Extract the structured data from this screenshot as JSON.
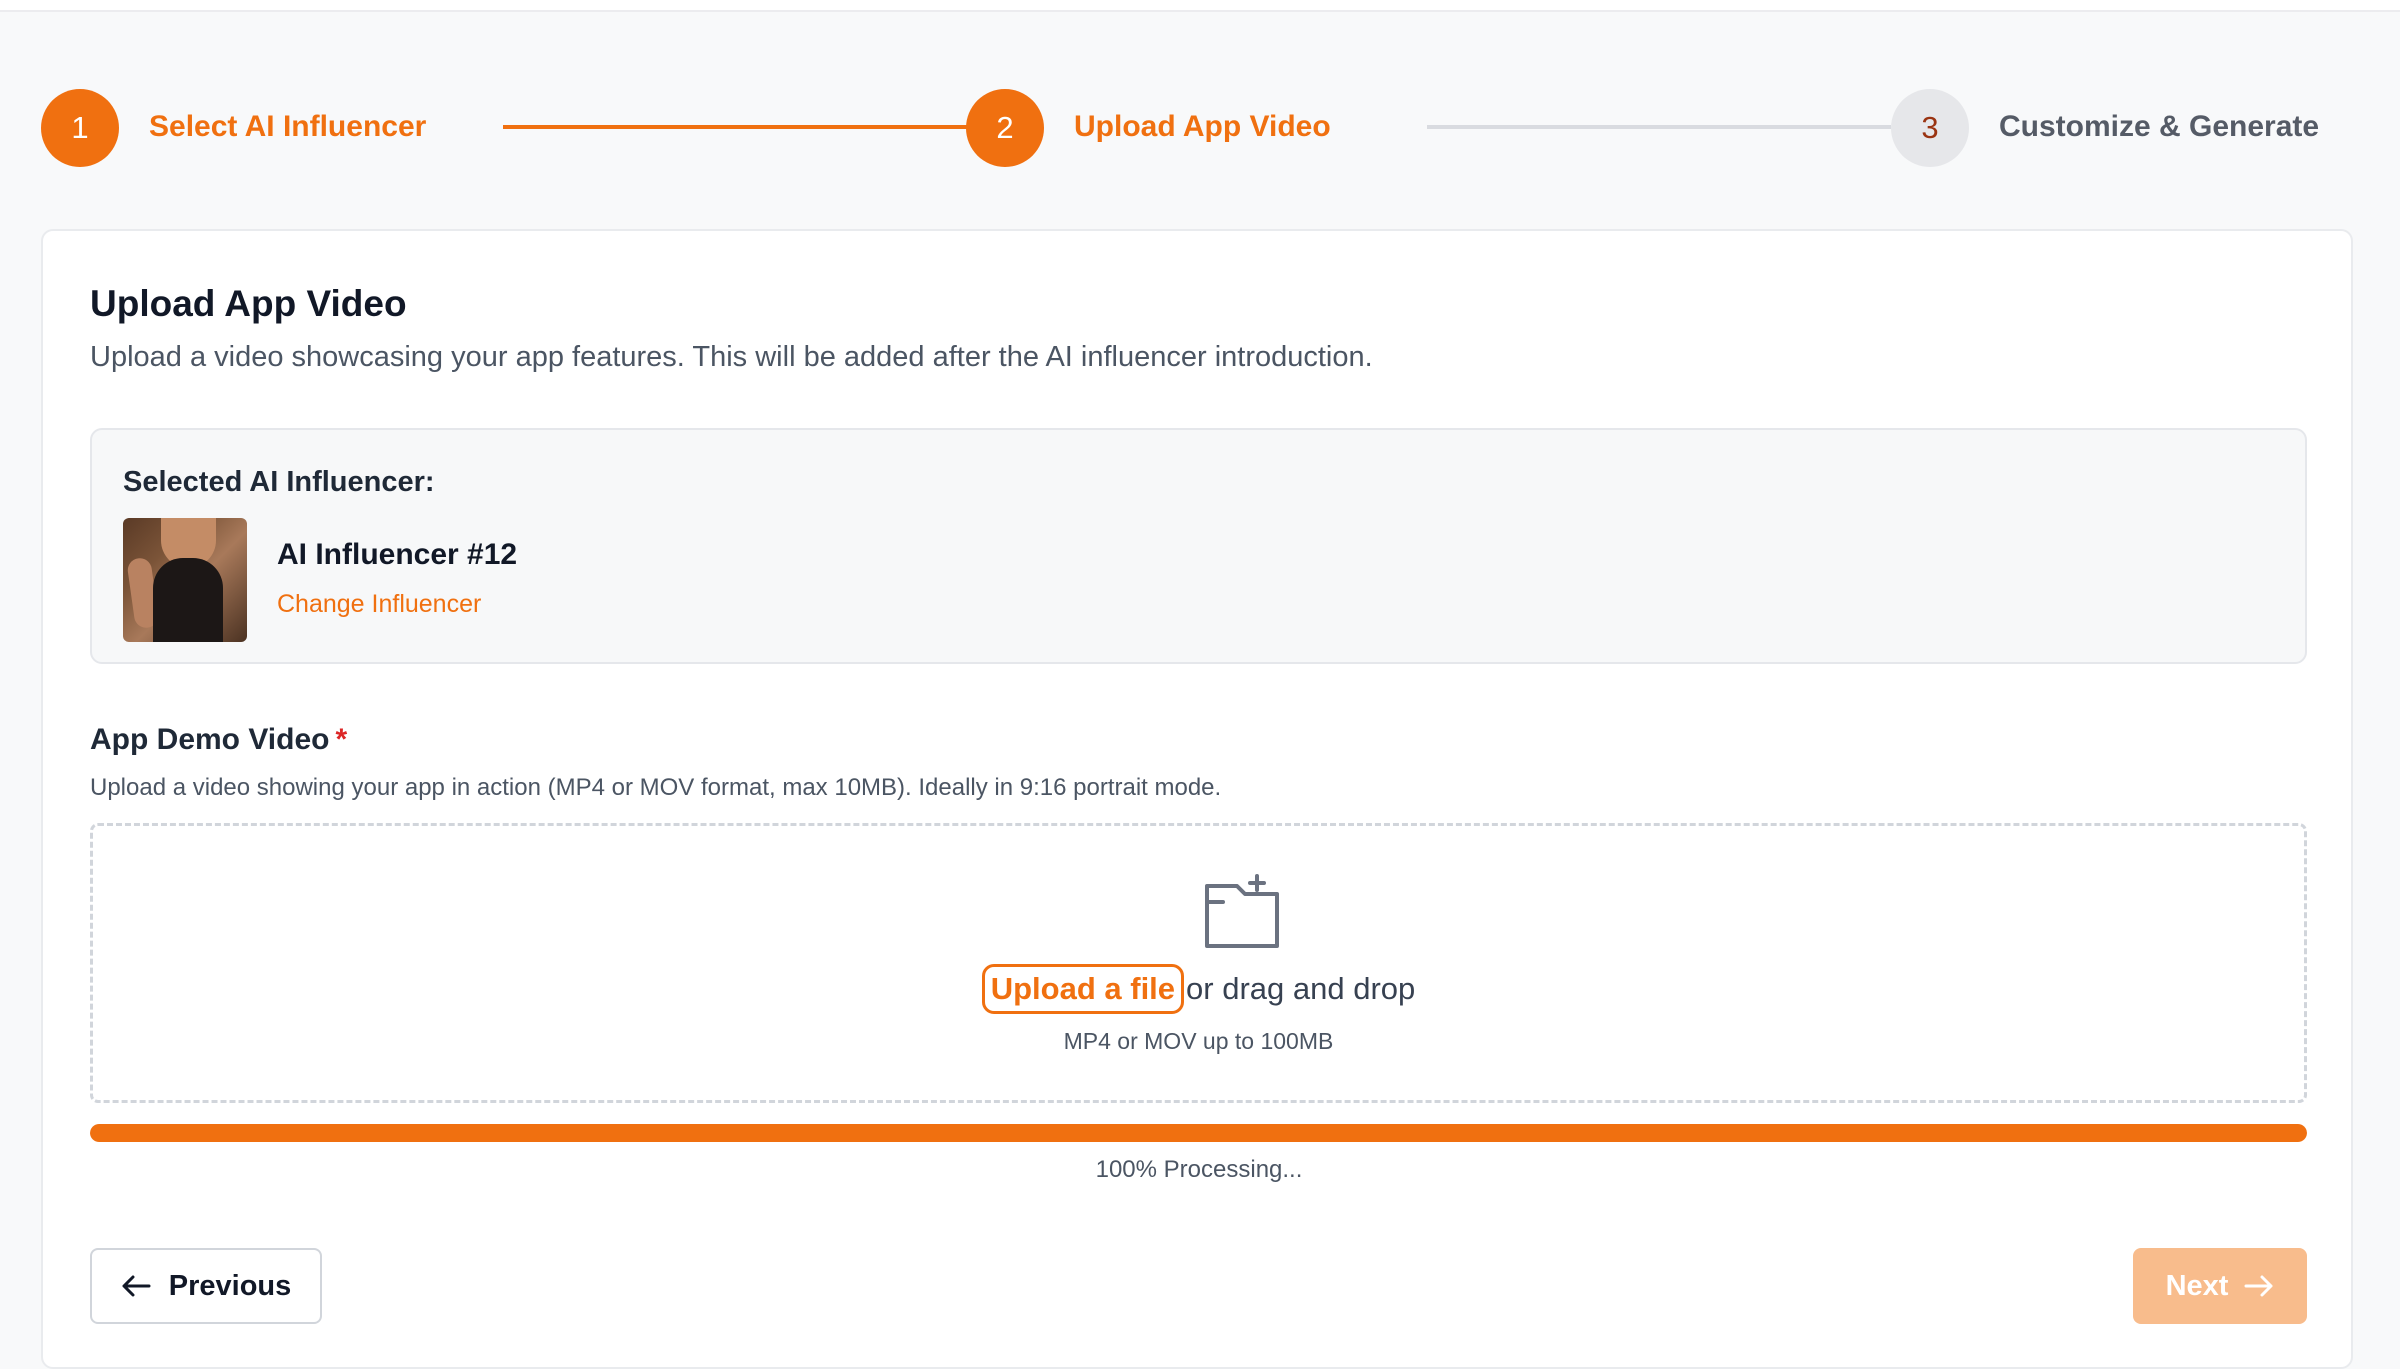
{
  "stepper": {
    "steps": [
      {
        "number": "1",
        "label": "Select AI Influencer",
        "state": "complete"
      },
      {
        "number": "2",
        "label": "Upload App Video",
        "state": "current"
      },
      {
        "number": "3",
        "label": "Customize & Generate",
        "state": "upcoming"
      }
    ]
  },
  "card": {
    "title": "Upload App Video",
    "subtitle": "Upload a video showcasing your app features. This will be added after the AI influencer introduction."
  },
  "influencer": {
    "section_label": "Selected AI Influencer:",
    "name": "AI Influencer #12",
    "change_label": "Change Influencer"
  },
  "video_field": {
    "label": "App Demo Video",
    "required_marker": "*",
    "help": "Upload a video showing your app in action (MP4 or MOV format, max 10MB). Ideally in 9:16 portrait mode.",
    "upload_link": "Upload a file",
    "upload_rest": "or drag and drop",
    "hint": "MP4 or MOV up to 100MB"
  },
  "progress": {
    "percent": 100,
    "text": "100% Processing..."
  },
  "nav": {
    "previous_label": "Previous",
    "next_label": "Next"
  },
  "icons": {
    "upload": "folder-icon",
    "previous": "arrow-left-icon",
    "next": "arrow-right-icon"
  },
  "colors": {
    "accent": "#f07010",
    "next_disabled": "#f8bc8c",
    "required": "#dc2626"
  }
}
